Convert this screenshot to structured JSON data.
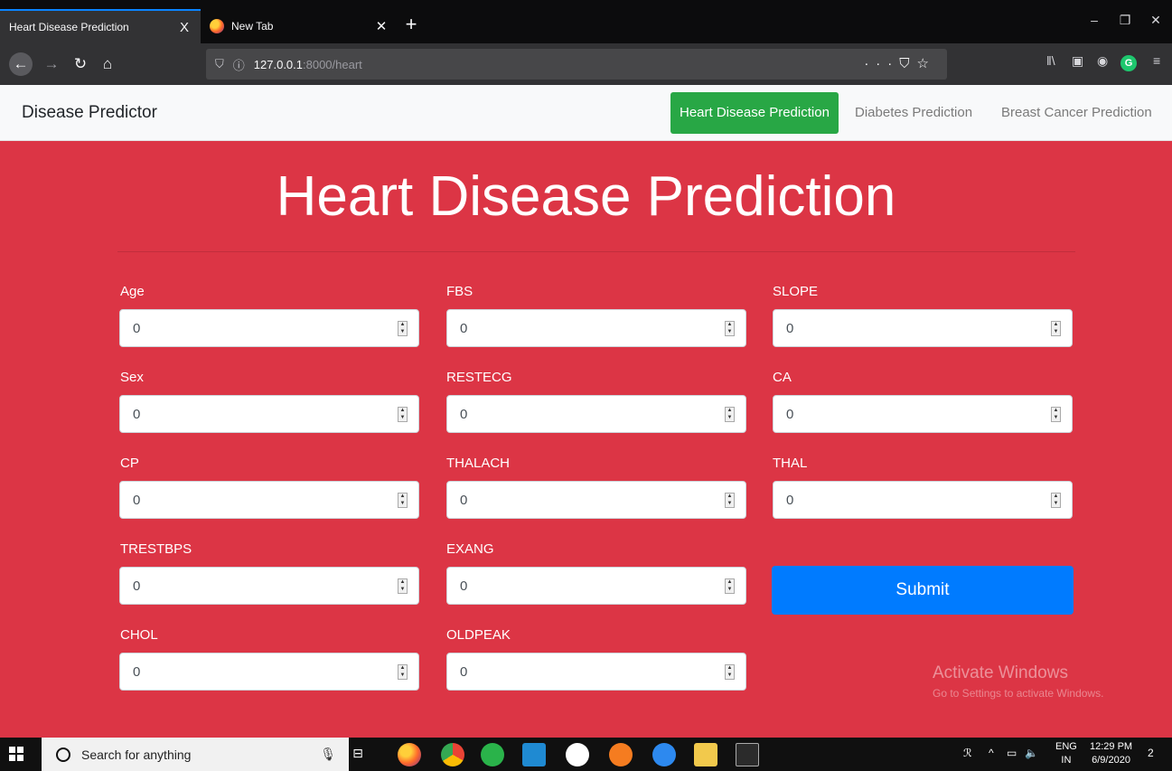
{
  "browser": {
    "tabs": [
      {
        "label": "Heart Disease Prediction",
        "active": true
      },
      {
        "label": "New Tab",
        "active": false
      }
    ],
    "url_host": "127.0.0.1",
    "url_path": ":8000/heart",
    "new_tab_symbol": "+",
    "close_symbol": "X"
  },
  "site_nav": {
    "brand": "Disease Predictor",
    "links": [
      {
        "label": "Heart Disease Prediction",
        "active": true
      },
      {
        "label": "Diabetes Prediction",
        "active": false
      },
      {
        "label": "Breast Cancer Prediction",
        "active": false
      }
    ]
  },
  "page": {
    "title": "Heart Disease Prediction",
    "submit_label": "Submit",
    "fields": {
      "age": {
        "label": "Age",
        "value": "0"
      },
      "sex": {
        "label": "Sex",
        "value": "0"
      },
      "cp": {
        "label": "CP",
        "value": "0"
      },
      "trestbps": {
        "label": "TRESTBPS",
        "value": "0"
      },
      "chol": {
        "label": "CHOL",
        "value": "0"
      },
      "fbs": {
        "label": "FBS",
        "value": "0"
      },
      "restecg": {
        "label": "RESTECG",
        "value": "0"
      },
      "thalach": {
        "label": "THALACH",
        "value": "0"
      },
      "exang": {
        "label": "EXANG",
        "value": "0"
      },
      "oldpeak": {
        "label": "OLDPEAK",
        "value": "0"
      },
      "slope": {
        "label": "SLOPE",
        "value": "0"
      },
      "ca": {
        "label": "CA",
        "value": "0"
      },
      "thal": {
        "label": "THAL",
        "value": "0"
      }
    }
  },
  "watermark": {
    "title": "Activate Windows",
    "subtitle": "Go to Settings to activate Windows."
  },
  "taskbar": {
    "search_placeholder": "Search for anything",
    "lang_top": "ENG",
    "lang_bottom": "IN",
    "time": "12:29 PM",
    "date": "6/9/2020",
    "notification_count": "2"
  },
  "colors": {
    "page_bg": "#dc3545",
    "active_nav": "#28a745",
    "submit": "#007bff"
  }
}
